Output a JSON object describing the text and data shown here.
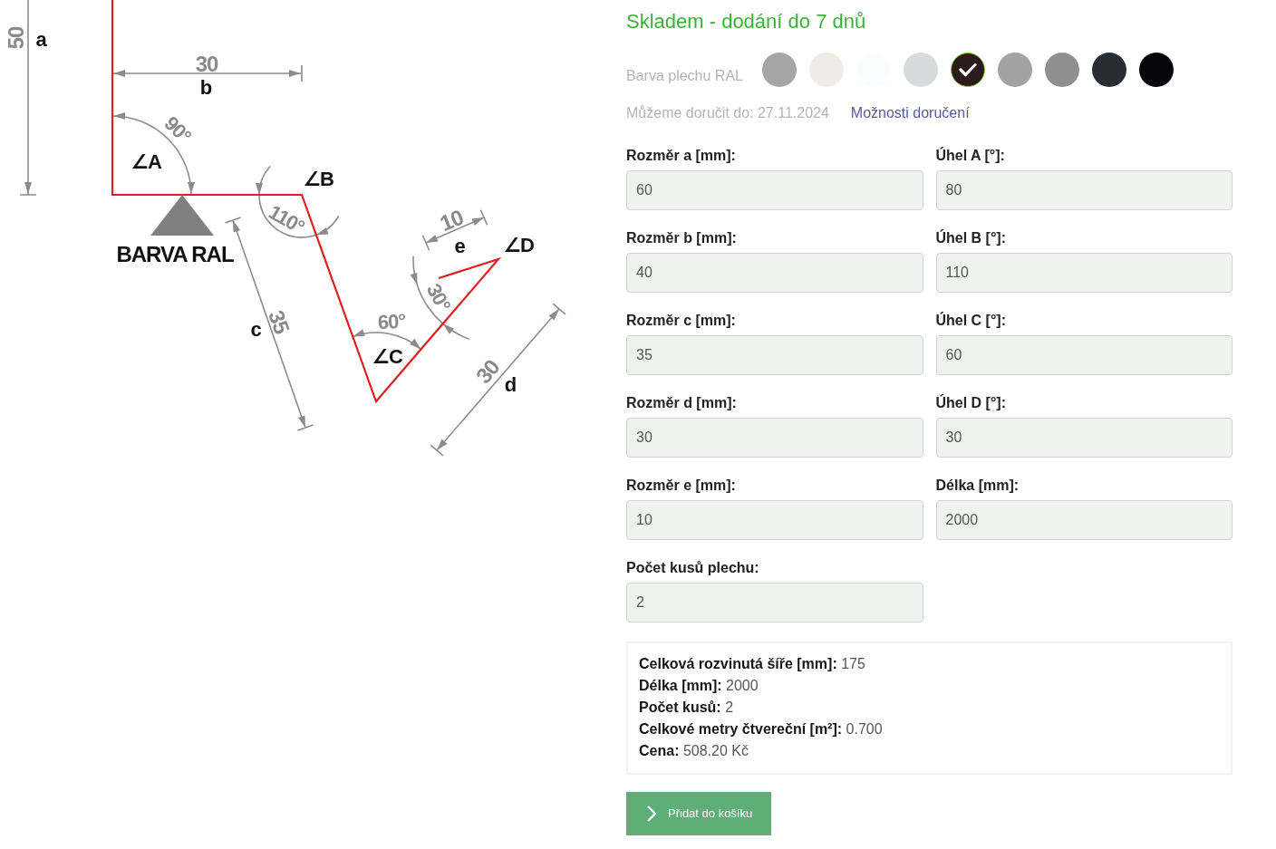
{
  "diagram": {
    "labels": [
      {
        "kind": "dimension",
        "text": "50"
      },
      {
        "kind": "side",
        "text": "a"
      },
      {
        "kind": "dimension",
        "text": "30"
      },
      {
        "kind": "side",
        "text": "b"
      },
      {
        "kind": "angle_value",
        "text": "90°"
      },
      {
        "kind": "angle_name",
        "text": "∠A"
      },
      {
        "kind": "angle_name",
        "text": "∠B"
      },
      {
        "kind": "angle_value",
        "text": "110°"
      },
      {
        "kind": "caption",
        "text": "BARVA RAL"
      },
      {
        "kind": "side",
        "text": "c"
      },
      {
        "kind": "dimension",
        "text": "35"
      },
      {
        "kind": "angle_value",
        "text": "60°"
      },
      {
        "kind": "angle_name",
        "text": "∠C"
      },
      {
        "kind": "dimension",
        "text": "10"
      },
      {
        "kind": "side",
        "text": "e"
      },
      {
        "kind": "angle_name",
        "text": "∠D"
      },
      {
        "kind": "angle_value",
        "text": "30°"
      },
      {
        "kind": "dimension",
        "text": "30"
      },
      {
        "kind": "side",
        "text": "d"
      }
    ]
  },
  "availability": "Skladem - dodání do 7 dnů",
  "color_picker": {
    "label": "Barva plechu RAL",
    "swatches": [
      {
        "color": "#a6a6a6",
        "selected": false
      },
      {
        "color": "#efebe5",
        "selected": false
      },
      {
        "color": "#fafcfd",
        "selected": false
      },
      {
        "color": "#d5dcdb",
        "selected": false
      },
      {
        "color": "#2b1b1b",
        "selected": true
      },
      {
        "color": "#a3a3a3",
        "selected": false
      },
      {
        "color": "#8f8f8f",
        "selected": false
      },
      {
        "color": "#262e33",
        "selected": false
      },
      {
        "color": "#05050a",
        "selected": false
      }
    ]
  },
  "delivery": {
    "text": "Můžeme doručit do: 27.11.2024",
    "link": "Možnosti doručení"
  },
  "fields": [
    {
      "label": "Rozměr a [mm]:",
      "value": "60"
    },
    {
      "label": "Úhel A [°]:",
      "value": "80"
    },
    {
      "label": "Rozměr b [mm]:",
      "value": "40"
    },
    {
      "label": "Úhel B [°]:",
      "value": "110"
    },
    {
      "label": "Rozměr c [mm]:",
      "value": "35"
    },
    {
      "label": "Úhel C [°]:",
      "value": "60"
    },
    {
      "label": "Rozměr d [mm]:",
      "value": "30"
    },
    {
      "label": "Úhel D [°]:",
      "value": "30"
    },
    {
      "label": "Rozměr e [mm]:",
      "value": "10"
    },
    {
      "label": "Délka [mm]:",
      "value": "2000"
    },
    {
      "label": "Počet kusů plechu:",
      "value": "2"
    }
  ],
  "summary": [
    {
      "label": "Celková rozvinutá šíře [mm]:",
      "value": "175"
    },
    {
      "label": "Délka [mm]:",
      "value": "2000"
    },
    {
      "label": "Počet kusů:",
      "value": "2"
    },
    {
      "label": "Celkové metry čtvereční [m²]:",
      "value": "0.700"
    },
    {
      "label": "Cena:",
      "value": "508.20 Kč"
    }
  ],
  "add_to_cart_button": {
    "label": "Přidat do košíku"
  }
}
